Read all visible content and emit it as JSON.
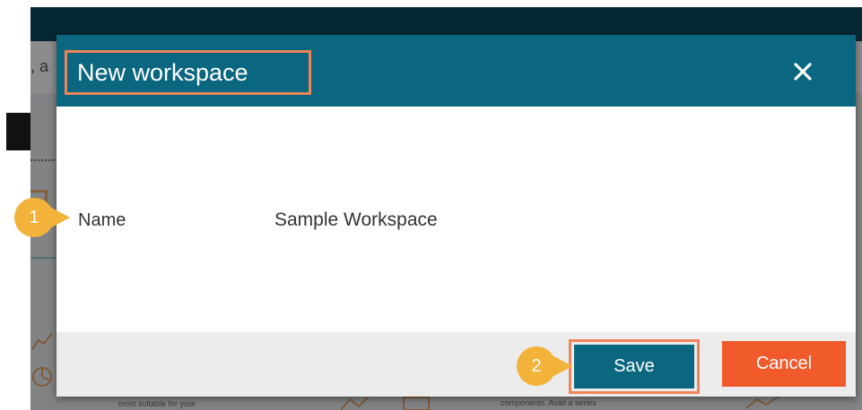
{
  "background": {
    "snippet_text": ", a",
    "card_text_left": "most suitable for your",
    "card_text_right": "components. Avail a series"
  },
  "dialog": {
    "title": "New workspace",
    "close_icon": "close-icon",
    "fields": [
      {
        "label": "Name",
        "value": "Sample Workspace"
      }
    ],
    "buttons": {
      "save_label": "Save",
      "cancel_label": "Cancel"
    }
  },
  "annotations": {
    "markers": [
      {
        "number": "1"
      },
      {
        "number": "2"
      }
    ]
  },
  "colors": {
    "header": "#0b6680",
    "save_button": "#0b6680",
    "cancel_button": "#f15a2b",
    "highlight": "#ee8559",
    "marker": "#f3b23a"
  }
}
